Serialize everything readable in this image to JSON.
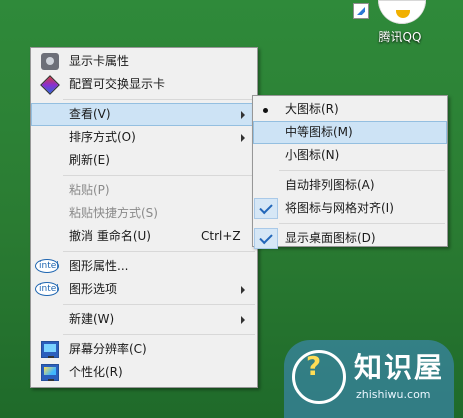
{
  "desktop": {
    "qq_label": "腾讯QQ"
  },
  "context_menu": {
    "items": [
      {
        "label": "显示卡属性",
        "icon": "graphics-card-icon"
      },
      {
        "label": "配置可交换显示卡",
        "icon": "switchable-graphics-icon"
      },
      {
        "label": "查看(V)",
        "has_submenu": true,
        "highlighted": true
      },
      {
        "label": "排序方式(O)",
        "has_submenu": true
      },
      {
        "label": "刷新(E)"
      },
      {
        "label": "粘贴(P)",
        "disabled": true
      },
      {
        "label": "粘贴快捷方式(S)",
        "disabled": true
      },
      {
        "label": "撤消 重命名(U)",
        "shortcut": "Ctrl+Z"
      },
      {
        "label": "图形属性...",
        "icon": "intel-icon"
      },
      {
        "label": "图形选项",
        "icon": "intel-icon",
        "has_submenu": true
      },
      {
        "label": "新建(W)",
        "has_submenu": true
      },
      {
        "label": "屏幕分辨率(C)",
        "icon": "screen-resolution-icon"
      },
      {
        "label": "个性化(R)",
        "icon": "personalize-icon"
      }
    ]
  },
  "view_submenu": {
    "items": [
      {
        "label": "大图标(R)",
        "selected": true
      },
      {
        "label": "中等图标(M)",
        "highlighted": true
      },
      {
        "label": "小图标(N)"
      },
      {
        "label": "自动排列图标(A)"
      },
      {
        "label": "将图标与网格对齐(I)",
        "checked": true
      },
      {
        "label": "显示桌面图标(D)",
        "checked": true
      }
    ]
  },
  "watermark": {
    "title": "知识屋",
    "url": "zhishiwu.com"
  },
  "colors": {
    "desktop_green": "#2a7b32",
    "menu_bg": "#f0f0f0",
    "highlight": "#cde3f5"
  }
}
